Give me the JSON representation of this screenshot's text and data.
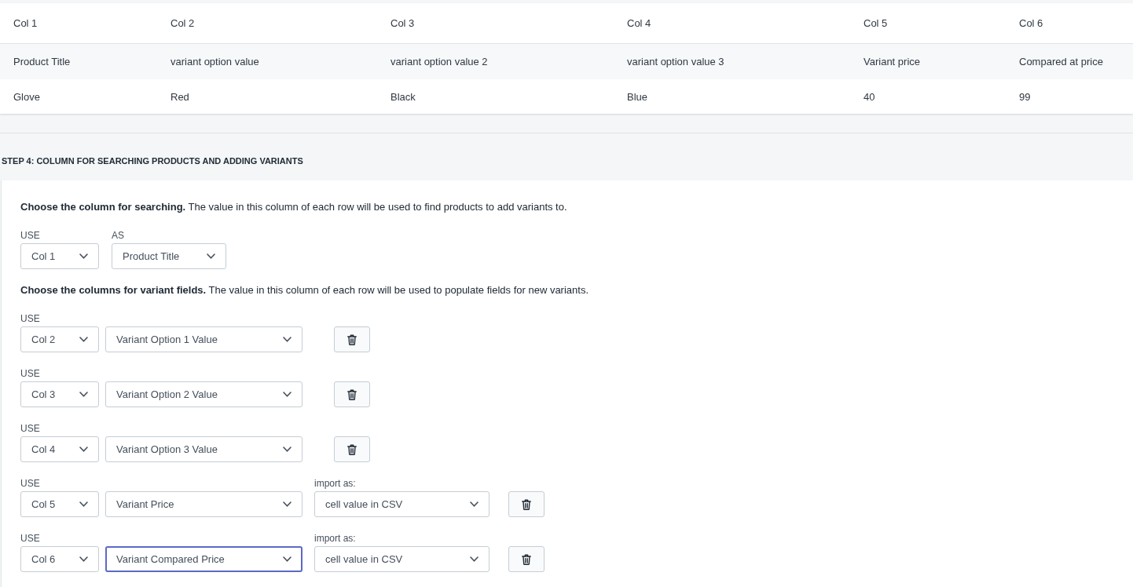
{
  "preview_table": {
    "columns": [
      "Col 1",
      "Col 2",
      "Col 3",
      "Col 4",
      "Col 5",
      "Col 6"
    ],
    "rows": [
      [
        "Product Title",
        "variant option value",
        "variant option value 2",
        "variant option value 3",
        "Variant price",
        "Compared at price"
      ],
      [
        "Glove",
        "Red",
        "Black",
        "Blue",
        "40",
        "99"
      ]
    ]
  },
  "step_4": {
    "title": "STEP 4: COLUMN FOR SEARCHING PRODUCTS AND ADDING VARIANTS",
    "search_column": {
      "instruction": "**Choose the column for searching.** The value in this column of each row will be used to find products to add variants to.",
      "use_label": "USE",
      "use_value": "Col 1",
      "as_label": "AS",
      "as_value": "Product Title"
    },
    "variant_fields": {
      "instruction": "**Choose the columns for variant fields.** The value in this column of each row will be used to populate fields for new variants.",
      "mappings": [
        {
          "use_label": "USE",
          "column": "Col 2",
          "field": "Variant Option 1 Value",
          "field_focused": false
        },
        {
          "use_label": "USE",
          "column": "Col 3",
          "field": "Variant Option 2 Value",
          "field_focused": false
        },
        {
          "use_label": "USE",
          "column": "Col 4",
          "field": "Variant Option 3 Value",
          "field_focused": false
        },
        {
          "use_label": "USE",
          "column": "Col 5",
          "field": "Variant Price",
          "field_focused": false,
          "import_label": "import as:",
          "import_as": "cell value in CSV"
        },
        {
          "use_label": "USE",
          "column": "Col 6",
          "field": "Variant Compared Price",
          "field_focused": true,
          "import_label": "import as:",
          "import_as": "cell value in CSV"
        }
      ]
    }
  }
}
